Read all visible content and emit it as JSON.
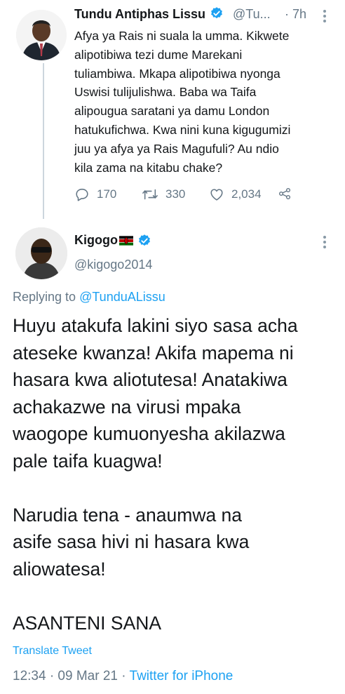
{
  "tweet1": {
    "name": "Tundu Antiphas Lissu",
    "handle": "@Tu...",
    "time": "· 7h",
    "lines": [
      "Afya ya Rais ni suala la umma. Kikwete",
      "alipotibiwa tezi dume Marekani",
      "tuliambiwa. Mkapa alipotibiwa nyonga",
      "Uswisi tulijulishwa. Baba wa Taifa",
      "alipougua saratani ya damu London",
      "hatukufichwa. Kwa nini kuna kigugumizi",
      "juu ya afya ya Rais Magufuli? Au ndio",
      "kila zama na kitabu chake?"
    ],
    "replies": "170",
    "retweets": "330",
    "likes": "2,034",
    "icons": [
      "reply-icon",
      "retweet-icon",
      "like-icon",
      "share-icon"
    ]
  },
  "tweet2": {
    "name": "Kigogo",
    "handle": "@kigogo2014",
    "replying_prefix": "Replying to",
    "replying_handle": "@TunduALissu",
    "paragraph1": [
      "Huyu atakufa lakini siyo sasa acha",
      "ateseke kwanza! Akifa mapema ni",
      "hasara kwa aliotutesa! Anatakiwa",
      "achakazwe na virusi mpaka",
      "waogope kumuonyesha akilazwa",
      "pale taifa kuagwa!"
    ],
    "paragraph2": [
      "Narudia tena - anaumwa na",
      "asife sasa hivi ni hasara kwa",
      "aliowatesa!"
    ],
    "paragraph3": [
      "ASANTENI SANA"
    ],
    "translate": "Translate Tweet",
    "time_date": "12:34 · 09 Mar 21 ·",
    "app": "Twitter for iPhone"
  },
  "colors": {
    "accent": "#1da1f2",
    "secondary_text": "#657786",
    "primary_text": "#14171a"
  }
}
